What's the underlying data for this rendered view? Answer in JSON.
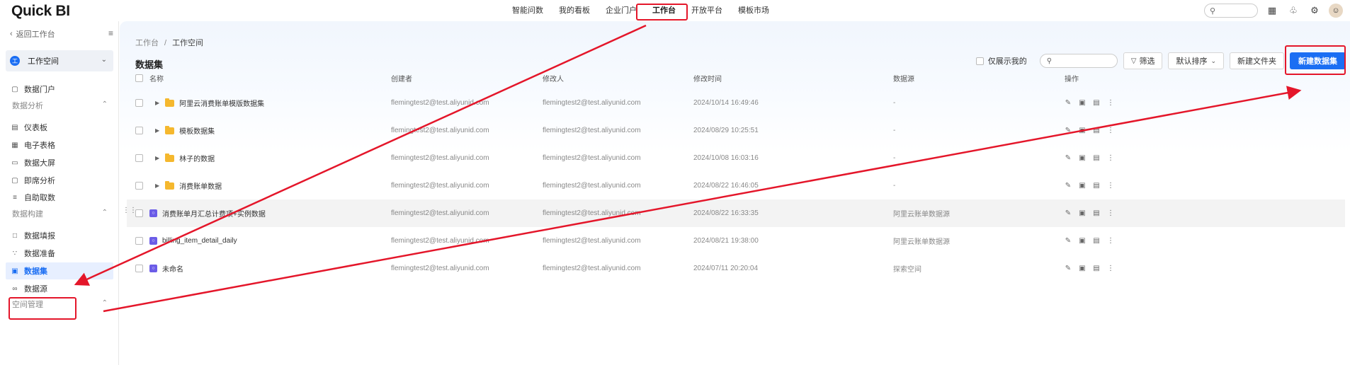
{
  "app": {
    "logo": "Quick BI",
    "nav": [
      {
        "label": "智能问数"
      },
      {
        "label": "我的看板"
      },
      {
        "label": "企业门户"
      },
      {
        "label": "工作台"
      },
      {
        "label": "开放平台"
      },
      {
        "label": "模板市场"
      }
    ]
  },
  "sidebar": {
    "back": "返回工作台",
    "workspace": {
      "badge": "工",
      "label": "工作空间"
    },
    "portal": "数据门户",
    "groups": {
      "analysis": "数据分析",
      "build": "数据构建",
      "space": "空间管理"
    },
    "analysis_items": [
      {
        "label": "仪表板",
        "icon": "dashboard-icon"
      },
      {
        "label": "电子表格",
        "icon": "spreadsheet-icon"
      },
      {
        "label": "数据大屏",
        "icon": "screen-icon"
      },
      {
        "label": "即席分析",
        "icon": "adhoc-icon"
      },
      {
        "label": "自助取数",
        "icon": "fetch-icon"
      }
    ],
    "build_items": [
      {
        "label": "数据填报",
        "icon": "form-icon"
      },
      {
        "label": "数据准备",
        "icon": "prep-icon"
      },
      {
        "label": "数据集",
        "icon": "dataset-icon"
      },
      {
        "label": "数据源",
        "icon": "datasource-icon"
      }
    ]
  },
  "main": {
    "breadcrumb": {
      "root": "工作台",
      "sep": "/",
      "current": "工作空间"
    },
    "title": "数据集",
    "toolbar": {
      "only_mine": "仅展示我的",
      "filter": "筛选",
      "sort": "默认排序",
      "new_folder": "新建文件夹",
      "new_dataset": "新建数据集"
    },
    "columns": {
      "name": "名称",
      "creator": "创建者",
      "modifier": "修改人",
      "modified": "修改时间",
      "source": "数据源",
      "ops": "操作"
    },
    "rows": [
      {
        "type": "folder",
        "name": "阿里云消费账单模版数据集",
        "creator": "flemingtest2@test.aliyunid.com",
        "modifier": "flemingtest2@test.aliyunid.com",
        "modified": "2024/10/14 16:49:46",
        "source": "-"
      },
      {
        "type": "folder",
        "name": "模板数据集",
        "creator": "flemingtest2@test.aliyunid.com",
        "modifier": "flemingtest2@test.aliyunid.com",
        "modified": "2024/08/29 10:25:51",
        "source": "-"
      },
      {
        "type": "folder",
        "name": "林子的数据",
        "creator": "flemingtest2@test.aliyunid.com",
        "modifier": "flemingtest2@test.aliyunid.com",
        "modified": "2024/10/08 16:03:16",
        "source": "-"
      },
      {
        "type": "folder",
        "name": "消费账单数据",
        "creator": "flemingtest2@test.aliyunid.com",
        "modifier": "flemingtest2@test.aliyunid.com",
        "modified": "2024/08/22 16:46:05",
        "source": "-"
      },
      {
        "type": "dataset",
        "name": "消费账单月汇总计费项+实例数据",
        "creator": "flemingtest2@test.aliyunid.com",
        "modifier": "flemingtest2@test.aliyunid.com",
        "modified": "2024/08/22 16:33:35",
        "source": "阿里云账单数据源"
      },
      {
        "type": "dataset",
        "name": "billing_item_detail_daily",
        "creator": "flemingtest2@test.aliyunid.com",
        "modifier": "flemingtest2@test.aliyunid.com",
        "modified": "2024/08/21 19:38:00",
        "source": "阿里云账单数据源"
      },
      {
        "type": "dataset",
        "name": "未命名",
        "creator": "flemingtest2@test.aliyunid.com",
        "modifier": "flemingtest2@test.aliyunid.com",
        "modified": "2024/07/11 20:20:04",
        "source": "探索空间"
      }
    ]
  },
  "colors": {
    "accent": "#1b6ef3",
    "annotation": "#e4162a",
    "folder": "#f5b82e",
    "dataset_icon": "#6b5ce7"
  }
}
